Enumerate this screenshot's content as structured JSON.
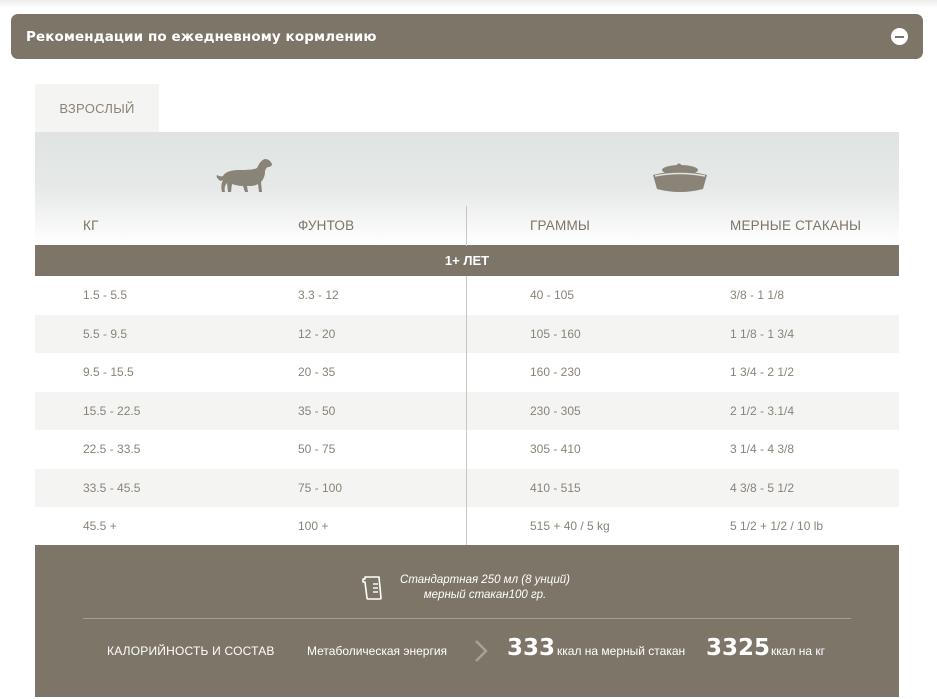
{
  "accordion": {
    "title": "Рекомендации по ежедневному кормлению"
  },
  "tabs": [
    {
      "label": "ВЗРОСЛЫЙ"
    }
  ],
  "table": {
    "columns": [
      "КГ",
      "ФУНТОВ",
      "ГРАММЫ",
      "МЕРНЫЕ СТАКАНЫ"
    ],
    "section": "1+ ЛЕТ",
    "rows": [
      [
        "1.5 - 5.5",
        "3.3 - 12",
        "40 - 105",
        "3/8 - 1 1/8"
      ],
      [
        "5.5 - 9.5",
        "12 - 20",
        "105 - 160",
        "1 1/8 - 1 3/4"
      ],
      [
        "9.5 - 15.5",
        "20 - 35",
        "160 - 230",
        "1 3/4 - 2 1/2"
      ],
      [
        "15.5 - 22.5",
        "35 - 50",
        "230 - 305",
        "2 1/2 - 3.1/4"
      ],
      [
        "22.5 - 33.5",
        "50 - 75",
        "305 - 410",
        "3 1/4 - 4 3/8"
      ],
      [
        "33.5 - 45.5",
        "75 - 100",
        "410 - 515",
        "4 3/8 - 5 1/2"
      ],
      [
        "45.5 +",
        "100 +",
        "515 + 40 / 5 kg",
        "5 1/2 + 1/2 / 10 lb"
      ]
    ]
  },
  "footer": {
    "cup_line1": "Стандартная 250 мл (8 унций)",
    "cup_line2": "мерный стакан100 гр.",
    "calories_label": "КАЛОРИЙНОСТЬ И СОСТАВ",
    "metabolic_label": "Метаболическая энергия",
    "kcal_per_cup_value": "333",
    "kcal_per_cup_unit": "ккал на мерный стакан",
    "kcal_per_kg_value": "3325",
    "kcal_per_kg_unit": "ккал на кг"
  },
  "colors": {
    "accent": "#7d7668",
    "stripe": "#f4f4f2",
    "text": "#8a8377"
  },
  "icons": [
    "minus-circle-icon",
    "dog-icon",
    "bowl-icon",
    "measuring-cup-icon",
    "chevron-right-icon"
  ]
}
